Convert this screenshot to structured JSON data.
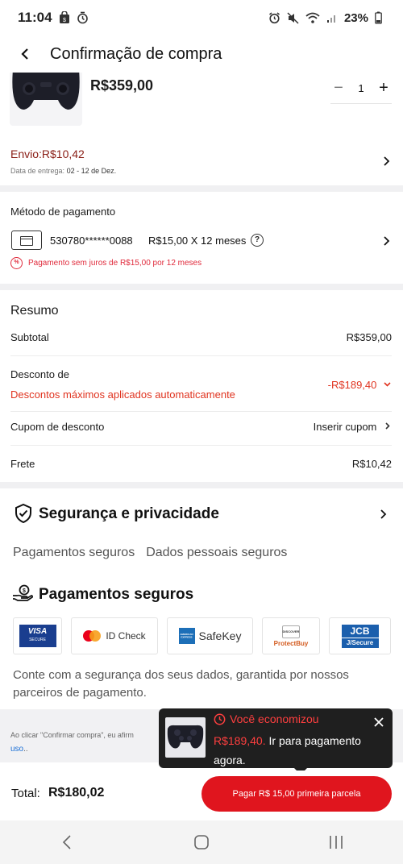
{
  "status_bar": {
    "time": "11:04",
    "battery": "23%"
  },
  "header": {
    "title": "Confirmação de compra"
  },
  "product": {
    "price": "R$359,00",
    "quantity": "1",
    "shipping": "Envio:R$10,42",
    "delivery_label": "Data de entrega:",
    "delivery_dates": "02 - 12 de Dez."
  },
  "payment": {
    "label": "Método de pagamento",
    "card_number": "530780******0088",
    "installment": "R$15,00 X 12 meses",
    "promo": "Pagamento sem juros de R$15,00 por 12 meses"
  },
  "summary": {
    "title": "Resumo",
    "subtotal_label": "Subtotal",
    "subtotal_value": "R$359,00",
    "discount_label": "Desconto de",
    "discount_sub": "Descontos máximos aplicados automaticamente",
    "discount_value": "-R$189,40",
    "coupon_label": "Cupom de desconto",
    "coupon_action": "Inserir cupom",
    "shipping_label": "Frete",
    "shipping_value": "R$10,42"
  },
  "security": {
    "title": "Segurança e privacidade",
    "tabs": [
      "Pagamentos seguros",
      "Dados pessoais seguros"
    ],
    "payments_title": "Pagamentos seguros",
    "logos": {
      "visa": "VISA",
      "visa_sub": "SECURE",
      "mastercard": "ID Check",
      "amex": "SafeKey",
      "amex_box": "AMERICAN EXPRESS",
      "discover_box": "DISCOVER",
      "discover": "ProtectBuy",
      "jcb": "JCB",
      "jcb_sub": "J/Secure"
    },
    "description": "Conte com a segurança dos seus dados, garantida por nossos parceiros de pagamento."
  },
  "legal": {
    "text": "Ao clicar \"Confirmar compra\", eu afirm",
    "link": "uso",
    "link_suffix": ".."
  },
  "toast": {
    "headline": "Você economizou",
    "amount": "R$189,40.",
    "message": " Ir para pagamento agora."
  },
  "footer": {
    "total_label": "Total:",
    "total_value": "R$180,02",
    "pay_button": "Pagar R$ 15,00 primeira parcela"
  },
  "colors": {
    "accent": "#e0151e",
    "discount_red": "#e0331f",
    "shipping_text": "#8b2018"
  }
}
